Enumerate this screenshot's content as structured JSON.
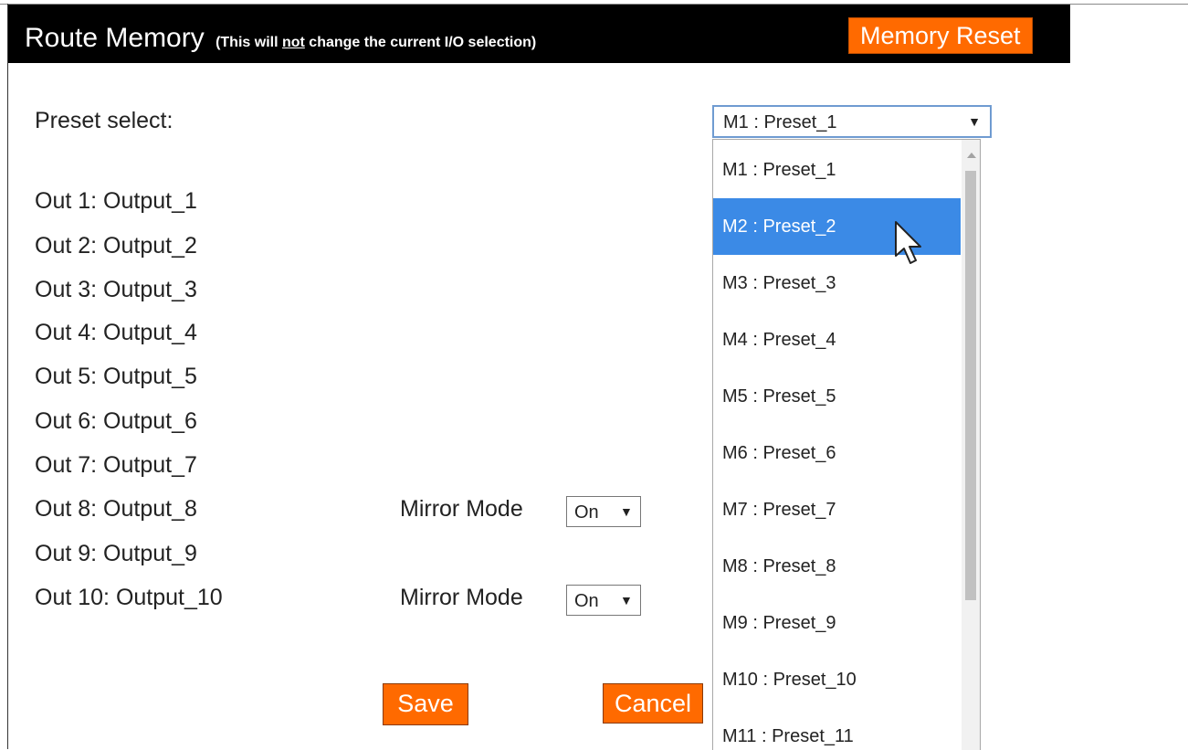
{
  "header": {
    "title": "Route Memory",
    "note_prefix": "(This will ",
    "note_emph": "not",
    "note_suffix": " change the current I/O selection)",
    "reset_label": "Memory Reset"
  },
  "preset": {
    "label": "Preset select:",
    "selected": "M1 : Preset_1",
    "options": [
      "M1 : Preset_1",
      "M2 : Preset_2",
      "M3 : Preset_3",
      "M4 : Preset_4",
      "M5 : Preset_5",
      "M6 : Preset_6",
      "M7 : Preset_7",
      "M8 : Preset_8",
      "M9 : Preset_9",
      "M10 : Preset_10",
      "M11 : Preset_11"
    ],
    "highlighted": "M2 : Preset_2"
  },
  "outputs": [
    "Out 1: Output_1",
    "Out 2: Output_2",
    "Out 3: Output_3",
    "Out 4: Output_4",
    "Out 5: Output_5",
    "Out 6: Output_6",
    "Out 7: Output_7",
    "Out 8: Output_8",
    "Out 9: Output_9",
    "Out 10: Output_10"
  ],
  "mirror": {
    "label": "Mirror Mode",
    "out8_value": "On",
    "out10_value": "On"
  },
  "buttons": {
    "save": "Save",
    "cancel": "Cancel"
  },
  "colors": {
    "accent": "#ff6a00",
    "highlight": "#3b8ae6",
    "header_bg": "#000000"
  },
  "icons": {
    "dropdown_arrow": "▼",
    "cursor": "pointer-cursor-icon"
  }
}
